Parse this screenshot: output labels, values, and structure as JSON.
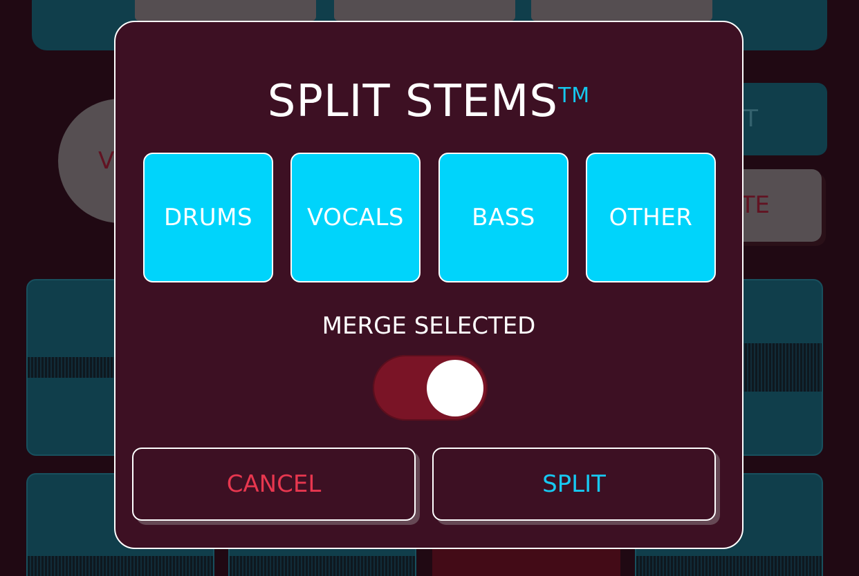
{
  "dialog": {
    "title": "SPLIT STEMS",
    "trademark": "TM",
    "stems": [
      {
        "label": "DRUMS"
      },
      {
        "label": "VOCALS"
      },
      {
        "label": "BASS"
      },
      {
        "label": "OTHER"
      }
    ],
    "merge_label": "MERGE SELECTED",
    "merge_toggle_on": true,
    "cancel_label": "CANCEL",
    "split_label": "SPLIT"
  },
  "background": {
    "circle_text": "V",
    "right_button_1": "T",
    "right_button_2": "TE"
  },
  "colors": {
    "dialog_bg": "#3d1023",
    "stem_button": "#00d4fb",
    "toggle_track": "#7a1426",
    "cancel_text": "#e8374f",
    "split_text": "#17c9f2",
    "trademark": "#15c8ee"
  }
}
